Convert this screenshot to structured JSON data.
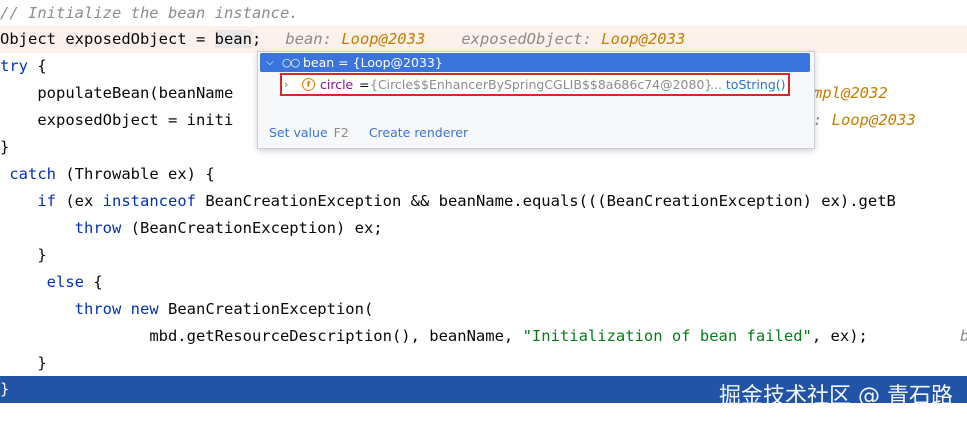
{
  "code": {
    "line1_comment": "// Initialize the bean instance.",
    "line2_code_a": "Object exposedObject = ",
    "line2_code_bean": "bean",
    "line2_code_b": ";",
    "line2_hint1_label": "bean: ",
    "line2_hint1_value": "Loop@2033",
    "line2_hint2_label": "exposedObject: ",
    "line2_hint2_value": "Loop@2033",
    "line3_kw": "try",
    "line3_rest": " {",
    "line4_code": "    populateBean(beanName",
    "line4_hint_tail": "mpl@2032",
    "line5_code": "    exposedObject = initi",
    "line5_hint_tail_label": ": ",
    "line5_hint_tail_value": "Loop@2033",
    "line6_code": "}",
    "line7_kw": "catch",
    "line7_rest": " (Throwable ex) {",
    "line8_kw": "if",
    "line8_rest_a": " (ex ",
    "line8_kw2": "instanceof",
    "line8_rest_b": " BeanCreationException && beanName.equals(((BeanCreationException) ex).getB",
    "line9_kw": "throw",
    "line9_rest": " (BeanCreationException) ex;",
    "line10_code": "}",
    "line11_kw": "else",
    "line11_rest": " {",
    "line12_kw": "throw",
    "line12_kw2": "new",
    "line12_rest": " BeanCreationException(",
    "line13_code_a": "mbd.getResourceDescription(), beanName, ",
    "line13_str": "\"Initialization of bean failed\"",
    "line13_code_b": ", ex);",
    "line13_hint_tail": "b",
    "line14_code": "}",
    "line15_code": "}"
  },
  "popup": {
    "header_label": "bean = {Loop@2033}",
    "row_name": "circle",
    "row_eq": " = ",
    "row_value": "{Circle$$EnhancerBySpringCGLIB$$8a686c74@2080}",
    "row_ellipsis": "... ",
    "row_tostring": "toString()",
    "set_value_label": "Set value",
    "set_value_shortcut": "F2",
    "create_renderer_label": "Create renderer"
  },
  "watermark": "掘金技术社区 @ 青石路",
  "colors": {
    "keyword": "#0033b3",
    "string": "#067d17",
    "hint_value": "#c77d00",
    "selection_line": "#2154a6",
    "popup_header": "#3b74dc",
    "highlight_border": "#d62828"
  }
}
